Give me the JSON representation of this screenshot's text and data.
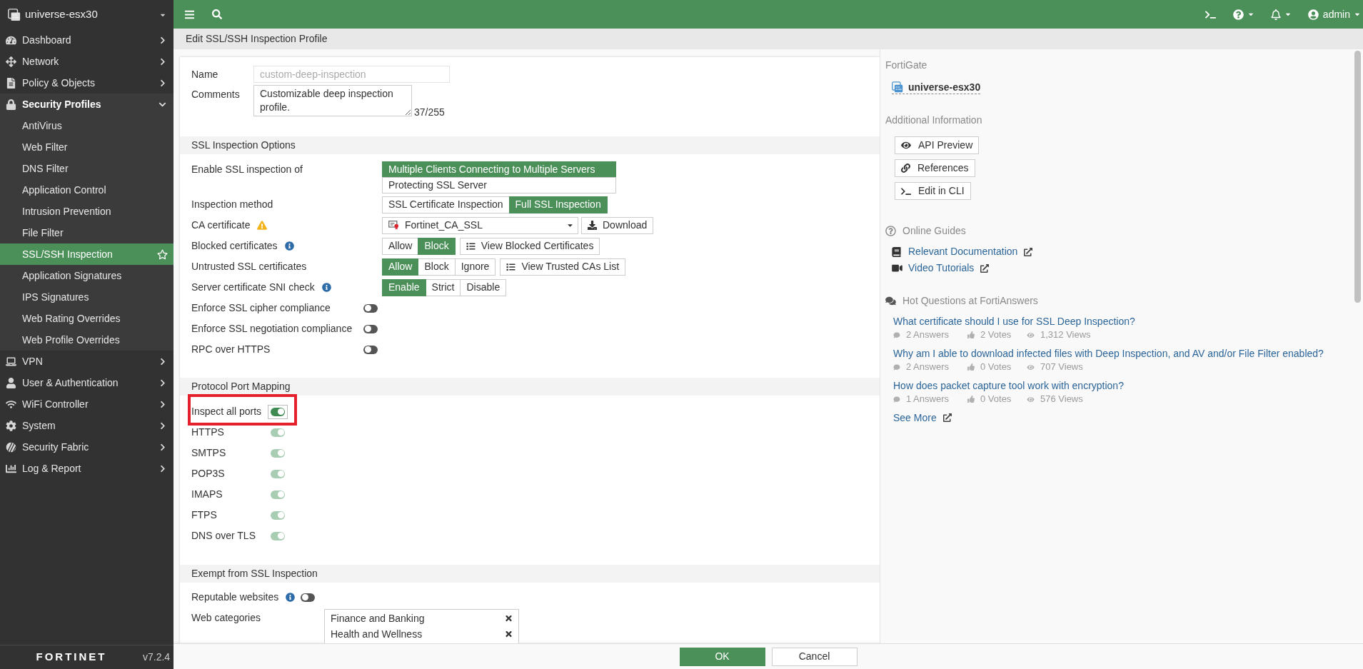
{
  "sidebar": {
    "device": "universe-esx30",
    "items": [
      {
        "label": "Dashboard",
        "expanded": false
      },
      {
        "label": "Network",
        "expanded": false
      },
      {
        "label": "Policy & Objects",
        "expanded": false
      },
      {
        "label": "Security Profiles",
        "expanded": true,
        "children": [
          {
            "label": "AntiVirus",
            "selected": false
          },
          {
            "label": "Web Filter",
            "selected": false
          },
          {
            "label": "DNS Filter",
            "selected": false
          },
          {
            "label": "Application Control",
            "selected": false
          },
          {
            "label": "Intrusion Prevention",
            "selected": false
          },
          {
            "label": "File Filter",
            "selected": false
          },
          {
            "label": "SSL/SSH Inspection",
            "selected": true
          },
          {
            "label": "Application Signatures",
            "selected": false
          },
          {
            "label": "IPS Signatures",
            "selected": false
          },
          {
            "label": "Web Rating Overrides",
            "selected": false
          },
          {
            "label": "Web Profile Overrides",
            "selected": false
          }
        ]
      },
      {
        "label": "VPN",
        "expanded": false
      },
      {
        "label": "User & Authentication",
        "expanded": false
      },
      {
        "label": "WiFi Controller",
        "expanded": false
      },
      {
        "label": "System",
        "expanded": false
      },
      {
        "label": "Security Fabric",
        "expanded": false
      },
      {
        "label": "Log & Report",
        "expanded": false
      }
    ],
    "logo": "FORTINET",
    "version": "v7.2.4"
  },
  "top_bar": {
    "user": "admin"
  },
  "breadcrumb": "Edit SSL/SSH Inspection Profile",
  "form": {
    "name": {
      "label": "Name",
      "value": "custom-deep-inspection",
      "disabled": true
    },
    "comments": {
      "label": "Comments",
      "value": "Customizable deep inspection profile.",
      "counter": "37/255"
    },
    "sections": [
      {
        "title": "SSL Inspection Options",
        "rows": [
          {
            "kind": "stacked",
            "label": "Enable SSL inspection of",
            "options": [
              {
                "label": "Multiple Clients Connecting to Multiple Servers",
                "selected": true
              },
              {
                "label": "Protecting SSL Server",
                "selected": false
              }
            ]
          },
          {
            "kind": "segmented",
            "label": "Inspection method",
            "options": [
              {
                "label": "SSL Certificate Inspection",
                "selected": false
              },
              {
                "label": "Full SSL Inspection",
                "selected": true
              }
            ]
          },
          {
            "kind": "select",
            "label": "CA certificate",
            "label_icon": {
              "kind": "warning"
            },
            "value": "Fortinet_CA_SSL",
            "action": "Download"
          },
          {
            "kind": "segmented",
            "label": "Blocked certificates",
            "label_icon": {
              "kind": "info"
            },
            "options": [
              {
                "label": "Allow",
                "selected": false
              },
              {
                "label": "Block",
                "selected": true
              }
            ],
            "action": "View Blocked Certificates"
          },
          {
            "kind": "segmented",
            "label": "Untrusted SSL certificates",
            "options": [
              {
                "label": "Allow",
                "selected": true
              },
              {
                "label": "Block",
                "selected": false
              },
              {
                "label": "Ignore",
                "selected": false
              }
            ],
            "action": "View Trusted CAs List"
          },
          {
            "kind": "segmented",
            "label": "Server certificate SNI check",
            "label_icon": {
              "kind": "info"
            },
            "options": [
              {
                "label": "Enable",
                "selected": true
              },
              {
                "label": "Strict",
                "selected": false
              },
              {
                "label": "Disable",
                "selected": false
              }
            ]
          },
          {
            "kind": "toggle",
            "label": "Enforce SSL cipher compliance",
            "on": false,
            "disabled": false
          },
          {
            "kind": "toggle",
            "label": "Enforce SSL negotiation compliance",
            "on": false,
            "disabled": false
          },
          {
            "kind": "toggle",
            "label": "RPC over HTTPS",
            "on": false,
            "disabled": false
          }
        ]
      },
      {
        "title": "Protocol Port Mapping",
        "rows": [
          {
            "kind": "toggle",
            "label": "Inspect all ports",
            "on": true,
            "disabled": false,
            "focused": true,
            "highlighted": true
          },
          {
            "kind": "toggle",
            "label": "HTTPS",
            "on": true,
            "disabled": true,
            "focused": false,
            "highlighted": false
          },
          {
            "kind": "toggle",
            "label": "SMTPS",
            "on": true,
            "disabled": true,
            "focused": false,
            "highlighted": false
          },
          {
            "kind": "toggle",
            "label": "POP3S",
            "on": true,
            "disabled": true,
            "focused": false,
            "highlighted": false
          },
          {
            "kind": "toggle",
            "label": "IMAPS",
            "on": true,
            "disabled": true,
            "focused": false,
            "highlighted": false
          },
          {
            "kind": "toggle",
            "label": "FTPS",
            "on": true,
            "disabled": true,
            "focused": false,
            "highlighted": false
          },
          {
            "kind": "toggle",
            "label": "DNS over TLS",
            "on": true,
            "disabled": true,
            "focused": false,
            "highlighted": false
          }
        ]
      },
      {
        "title": "Exempt from SSL Inspection",
        "rows": [
          {
            "kind": "toggle",
            "label": "Reputable websites",
            "label_icon": {
              "kind": "info"
            },
            "on": false,
            "disabled": false
          },
          {
            "kind": "list",
            "label": "Web categories",
            "items": [
              "Finance and Banking",
              "Health and Wellness"
            ]
          }
        ]
      }
    ]
  },
  "info_panel": {
    "device_heading": "FortiGate",
    "device": "universe-esx30",
    "additional_heading": "Additional Information",
    "buttons": [
      "API Preview",
      "References",
      "Edit in CLI"
    ],
    "guides_heading": "Online Guides",
    "guides": [
      "Relevant Documentation",
      "Video Tutorials"
    ],
    "questions_heading": "Hot Questions at FortiAnswers",
    "questions": [
      {
        "title": "What certificate should I use for SSL Deep Inspection?",
        "answers": "2 Answers",
        "votes": "2 Votes",
        "views": "1,312 Views"
      },
      {
        "title": "Why am I able to download infected files with Deep Inspection, and AV and/or File Filter enabled?",
        "answers": "2 Answers",
        "votes": "0 Votes",
        "views": "707 Views"
      },
      {
        "title": "How does packet capture tool work with encryption?",
        "answers": "1 Answers",
        "votes": "0 Votes",
        "views": "576 Views"
      }
    ],
    "see_more": "See More"
  },
  "footer": {
    "buttons": [
      {
        "label": "OK",
        "kind": "primary"
      },
      {
        "label": "Cancel",
        "kind": "secondary"
      }
    ]
  }
}
